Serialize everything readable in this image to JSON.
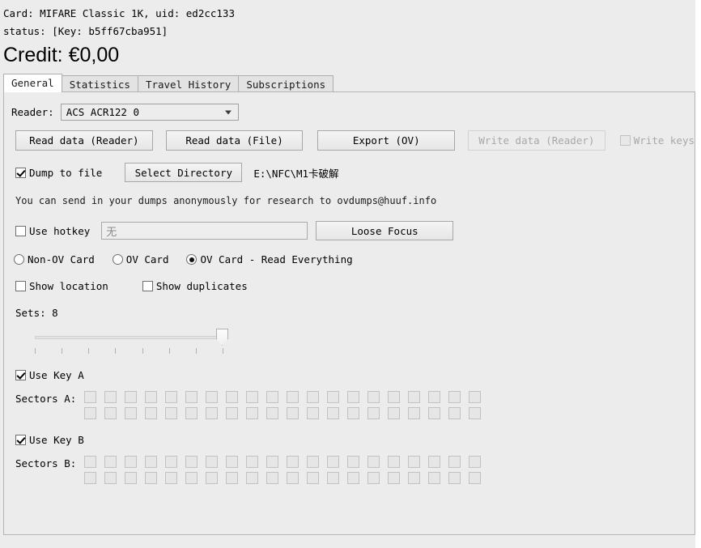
{
  "header": {
    "card_line": "Card: MIFARE Classic 1K, uid: ed2cc133",
    "status_line": "status: [Key: b5ff67cba951]",
    "credit": "Credit: €0,00"
  },
  "tabs": [
    {
      "label": "General",
      "active": true
    },
    {
      "label": "Statistics",
      "active": false
    },
    {
      "label": "Travel History",
      "active": false
    },
    {
      "label": "Subscriptions",
      "active": false
    }
  ],
  "general": {
    "reader_label": "Reader:",
    "reader_value": "ACS ACR122 0",
    "reader_icon": "chevron-down-icon",
    "buttons": {
      "read_reader": "Read data (Reader)",
      "read_file": "Read data (File)",
      "export_ov": "Export (OV)",
      "write_reader": "Write data (Reader)",
      "select_directory": "Select Directory",
      "loose_focus": "Loose Focus"
    },
    "write_keys_label": "Write keys",
    "dump_to_file_label": "Dump to file",
    "dump_path": "E:\\NFC\\M1卡破解",
    "research_note": "You can send in your dumps anonymously for research to ovdumps@huuf.info",
    "use_hotkey_label": "Use hotkey",
    "hotkey_value": "无",
    "radios": [
      {
        "label": "Non-OV Card",
        "selected": false
      },
      {
        "label": "OV Card",
        "selected": false
      },
      {
        "label": "OV Card - Read Everything",
        "selected": true
      }
    ],
    "show_location_label": "Show location",
    "show_duplicates_label": "Show duplicates",
    "sets_label": "Sets: 8",
    "sets_value": 8,
    "sets_ticks": 8,
    "use_key_a_label": "Use Key A",
    "sectors_a_label": "Sectors A:",
    "use_key_b_label": "Use Key B",
    "sectors_b_label": "Sectors B:",
    "sector_columns": 20,
    "sector_rows": 2
  },
  "state": {
    "dump_to_file_checked": true,
    "write_keys_checked": false,
    "write_keys_enabled": false,
    "write_reader_enabled": false,
    "use_hotkey_checked": false,
    "show_location_checked": false,
    "show_duplicates_checked": false,
    "use_key_a_checked": true,
    "use_key_b_checked": true,
    "sectors_enabled": false
  },
  "colors": {
    "window_bg": "#ececed",
    "panel_bg": "#ececed",
    "tab_active_bg": "#ffffff",
    "tab_inactive_bg": "#e3e3e3",
    "border": "#aeaeae",
    "disabled_text": "#a8a8a8",
    "text": "#000000"
  }
}
